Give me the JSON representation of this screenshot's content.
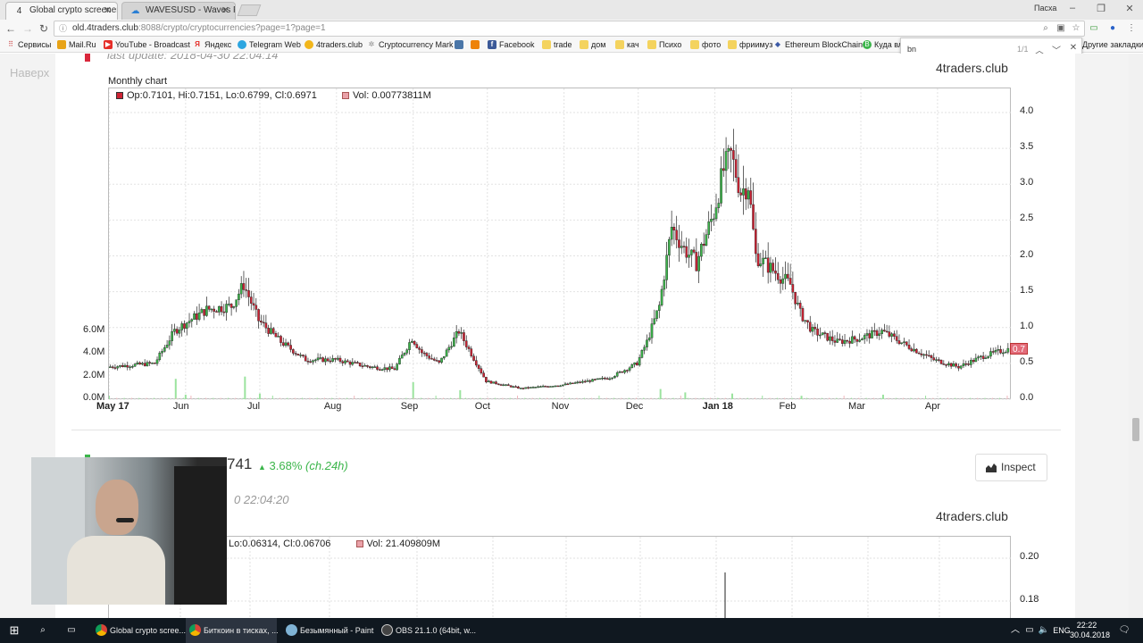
{
  "browser": {
    "tabs": [
      {
        "title": "Global crypto screener | ",
        "icon": "4traders-icon"
      },
      {
        "title": "WAVESUSD - Waves Pric",
        "icon": "tradingview-icon"
      }
    ],
    "profile_name": "Пасха",
    "url_host": "old.4traders.club",
    "url_rest": ":8088/crypto/cryptocurrencies?page=1?page=1",
    "bookmarks": [
      {
        "label": "Сервисы",
        "icon": "apps-icon"
      },
      {
        "label": "Mail.Ru",
        "icon": "mailru-icon"
      },
      {
        "label": "YouTube - Broadcast",
        "icon": "youtube-icon"
      },
      {
        "label": "Яндекс",
        "icon": "yandex-icon"
      },
      {
        "label": "Telegram Web",
        "icon": "telegram-icon"
      },
      {
        "label": "4traders.club",
        "icon": "4traders-icon"
      },
      {
        "label": "Cryptocurrency Mark",
        "icon": "coinmarket-icon"
      },
      {
        "label": "",
        "icon": "vk-icon"
      },
      {
        "label": "",
        "icon": "ok-icon"
      },
      {
        "label": "Facebook",
        "icon": "facebook-icon"
      },
      {
        "label": "trade",
        "icon": "folder-icon"
      },
      {
        "label": "дом",
        "icon": "folder-icon"
      },
      {
        "label": "кач",
        "icon": "folder-icon"
      },
      {
        "label": "Психо",
        "icon": "folder-icon"
      },
      {
        "label": "фото",
        "icon": "folder-icon"
      },
      {
        "label": "фриимуз",
        "icon": "folder-icon"
      },
      {
        "label": "Ethereum BlockChain",
        "icon": "ethereum-icon"
      },
      {
        "label": "Куда вло",
        "icon": "bitcoin-icon"
      }
    ],
    "other_bookmarks": "Другие закладки",
    "find_query": "bn",
    "find_count": "1/1"
  },
  "page": {
    "back_to_top": "Наверх",
    "last_update": "last update: 2018-04-30 22:04:14",
    "brand": "4traders.club",
    "chart_label": "Monthly chart",
    "legend_ohlc": "Op:0.7101, Hi:0.7151, Lo:0.6799, Cl:0.6971",
    "legend_vol": "Vol: 0.00773811M",
    "price_badge": "0.7",
    "second": {
      "price": "741",
      "change": "3.68%",
      "change_period": "(ch.24h)",
      "time": "0 22:04:20",
      "brand": "4traders.club",
      "legend_ohlc": "Lo:0.06314, Cl:0.06706",
      "legend_vol": "Vol: 21.409809M",
      "inspect_label": "Inspect"
    }
  },
  "chart_data": [
    {
      "type": "candlestick",
      "title": "Monthly chart",
      "x_ticks": [
        "May 17",
        "Jun",
        "Jul",
        "Aug",
        "Sep",
        "Oct",
        "Nov",
        "Dec",
        "Jan 18",
        "Feb",
        "Mar",
        "Apr"
      ],
      "price_axis": {
        "ticks": [
          "0.0",
          "0.5",
          "1.0",
          "1.5",
          "2.0",
          "2.5",
          "3.0",
          "3.5",
          "4.0"
        ],
        "range": [
          0,
          4.0
        ]
      },
      "volume_axis": {
        "ticks": [
          "0.0M",
          "2.0M",
          "4.0M",
          "6.0M"
        ],
        "range": [
          0,
          6
        ]
      },
      "grid": true,
      "last_close": 0.6971,
      "close_series": {
        "months": [
          "2017-05",
          "2017-06",
          "2017-07",
          "2017-08",
          "2017-09",
          "2017-10",
          "2017-11",
          "2017-12",
          "2018-01",
          "2018-02",
          "2018-03",
          "2018-04"
        ],
        "points": [
          [
            "2017-05-01",
            0.45
          ],
          [
            "2017-05-20",
            0.5
          ],
          [
            "2017-05-28",
            0.95
          ],
          [
            "2017-06-01",
            1.05
          ],
          [
            "2017-06-10",
            1.25
          ],
          [
            "2017-06-20",
            1.3
          ],
          [
            "2017-06-25",
            1.6
          ],
          [
            "2017-07-01",
            1.1
          ],
          [
            "2017-07-10",
            0.8
          ],
          [
            "2017-07-20",
            0.55
          ],
          [
            "2017-08-01",
            0.55
          ],
          [
            "2017-08-15",
            0.45
          ],
          [
            "2017-08-25",
            0.42
          ],
          [
            "2017-09-01",
            0.85
          ],
          [
            "2017-09-05",
            0.65
          ],
          [
            "2017-09-12",
            0.5
          ],
          [
            "2017-09-20",
            0.95
          ],
          [
            "2017-10-01",
            0.25
          ],
          [
            "2017-10-15",
            0.15
          ],
          [
            "2017-11-01",
            0.2
          ],
          [
            "2017-11-20",
            0.3
          ],
          [
            "2017-12-01",
            0.5
          ],
          [
            "2017-12-05",
            0.8
          ],
          [
            "2017-12-10",
            1.3
          ],
          [
            "2017-12-15",
            2.4
          ],
          [
            "2017-12-20",
            2.1
          ],
          [
            "2017-12-25",
            1.9
          ],
          [
            "2018-01-01",
            2.6
          ],
          [
            "2018-01-05",
            3.2
          ],
          [
            "2018-01-08",
            3.4
          ],
          [
            "2018-01-12",
            2.9
          ],
          [
            "2018-01-15",
            3.0
          ],
          [
            "2018-01-18",
            2.0
          ],
          [
            "2018-01-25",
            1.8
          ],
          [
            "2018-02-01",
            1.6
          ],
          [
            "2018-02-05",
            1.2
          ],
          [
            "2018-02-10",
            0.95
          ],
          [
            "2018-02-20",
            0.8
          ],
          [
            "2018-03-01",
            0.85
          ],
          [
            "2018-03-10",
            0.95
          ],
          [
            "2018-03-20",
            0.75
          ],
          [
            "2018-03-31",
            0.55
          ],
          [
            "2018-04-10",
            0.45
          ],
          [
            "2018-04-20",
            0.6
          ],
          [
            "2018-04-30",
            0.7
          ]
        ]
      },
      "volume_series": {
        "points": [
          [
            "2017-05-28",
            1.8
          ],
          [
            "2017-06-01",
            0.4
          ],
          [
            "2017-06-25",
            2.0
          ],
          [
            "2017-07-01",
            0.5
          ],
          [
            "2017-09-01",
            1.5
          ],
          [
            "2017-09-20",
            0.8
          ],
          [
            "2017-12-10",
            0.9
          ],
          [
            "2017-12-20",
            0.6
          ],
          [
            "2018-01-08",
            0.5
          ],
          [
            "2018-02-05",
            0.3
          ],
          [
            "2018-03-10",
            0.4
          ]
        ]
      }
    },
    {
      "type": "candlestick",
      "price_axis": {
        "ticks": [
          "0.20",
          "0.18"
        ],
        "range": [
          0.16,
          0.21
        ]
      },
      "legend_ohlc": "Lo:0.06314, Cl:0.06706",
      "legend_vol": "Vol: 21.409809M"
    }
  ],
  "taskbar": {
    "items": [
      {
        "label": "Global crypto scree...",
        "icon": "chrome-icon",
        "active": false
      },
      {
        "label": "Биткоин в тисках, ...",
        "icon": "chrome-icon",
        "active": true
      },
      {
        "label": "Безымянный - Paint",
        "icon": "paint-icon",
        "active": false
      },
      {
        "label": "OBS 21.1.0 (64bit, w...",
        "icon": "obs-icon",
        "active": false
      }
    ],
    "lang": "ENG",
    "time": "22:22",
    "date": "30.04.2018"
  },
  "colors": {
    "up_candle": "#3bb54a",
    "down_candle": "#cc2233",
    "volume": "#9be39e",
    "accent_green": "#3bb54a",
    "accent_red": "#d9273b"
  }
}
